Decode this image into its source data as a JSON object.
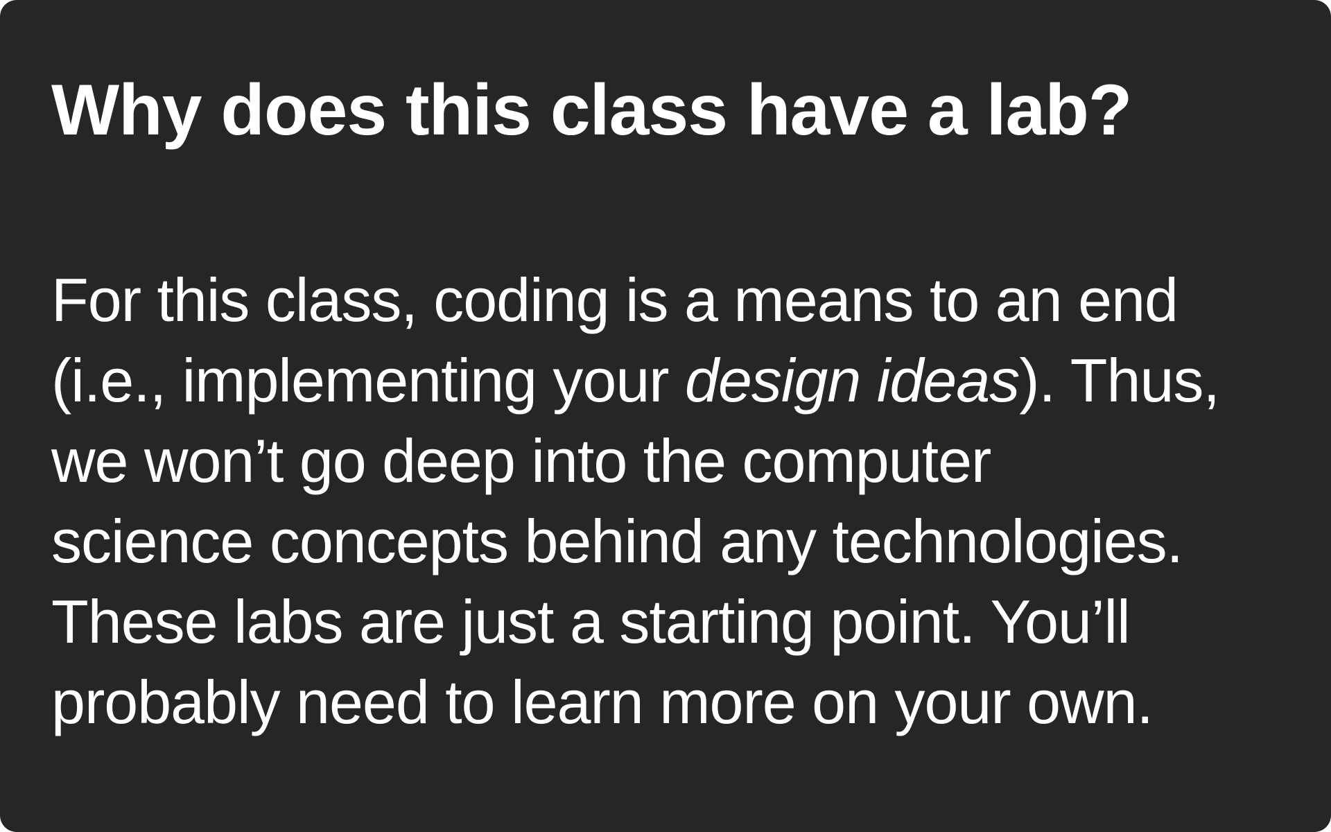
{
  "slide": {
    "title": "Why does this class have a lab?",
    "body": {
      "line1": "For this class, coding is a means to an end",
      "line2_before": "(i.e., implementing your ",
      "line2_emphasis": "design ideas",
      "line2_after": "). Thus,",
      "line3": "we won’t go deep into the computer",
      "line4": "science concepts behind any technologies.",
      "line5": "These labs are just a starting point. You’ll",
      "line6": "probably need to learn more on your own."
    }
  }
}
